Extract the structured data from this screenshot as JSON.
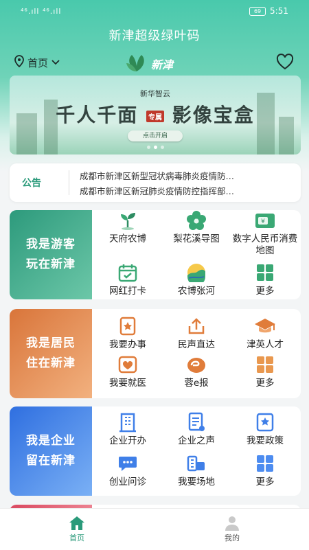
{
  "status": {
    "signal": "⁴⁶.ıll ⁴⁶.ıll",
    "battery": "69",
    "time": "5:51"
  },
  "app_title": "新津超级绿叶码",
  "nav": {
    "location": "首页",
    "logo_text": "新津"
  },
  "banner": {
    "brand": "新华智云",
    "headline_a": "千人千面",
    "tag": "专属",
    "headline_b": "影像宝盒",
    "cta": "点击开启"
  },
  "notice": {
    "label": "公告",
    "lines": [
      "成都市新津区新型冠状病毒肺炎疫情防…",
      "成都市新津区新冠肺炎疫情防控指挥部…"
    ]
  },
  "sections": [
    {
      "title": [
        "我是游客",
        "玩在新津"
      ],
      "items": [
        {
          "label": "天府农博"
        },
        {
          "label": "梨花溪导图"
        },
        {
          "label": "数字人民币消费地图"
        },
        {
          "label": "网红打卡"
        },
        {
          "label": "农博张河"
        },
        {
          "label": "更多"
        }
      ]
    },
    {
      "title": [
        "我是居民",
        "住在新津"
      ],
      "items": [
        {
          "label": "我要办事"
        },
        {
          "label": "民声直达"
        },
        {
          "label": "津英人才"
        },
        {
          "label": "我要就医"
        },
        {
          "label": "蓉e报"
        },
        {
          "label": "更多"
        }
      ]
    },
    {
      "title": [
        "我是企业",
        "留在新津"
      ],
      "items": [
        {
          "label": "企业开办"
        },
        {
          "label": "企业之声"
        },
        {
          "label": "我要政策"
        },
        {
          "label": "创业问诊"
        },
        {
          "label": "我要场地"
        },
        {
          "label": "更多"
        }
      ]
    }
  ],
  "tabs": [
    {
      "label": "首页",
      "active": true
    },
    {
      "label": "我的",
      "active": false
    }
  ],
  "colors": {
    "accent": "#3cc39f",
    "tourist": "#3fae8e",
    "resident": "#e3874a",
    "business": "#3f7fe8"
  }
}
